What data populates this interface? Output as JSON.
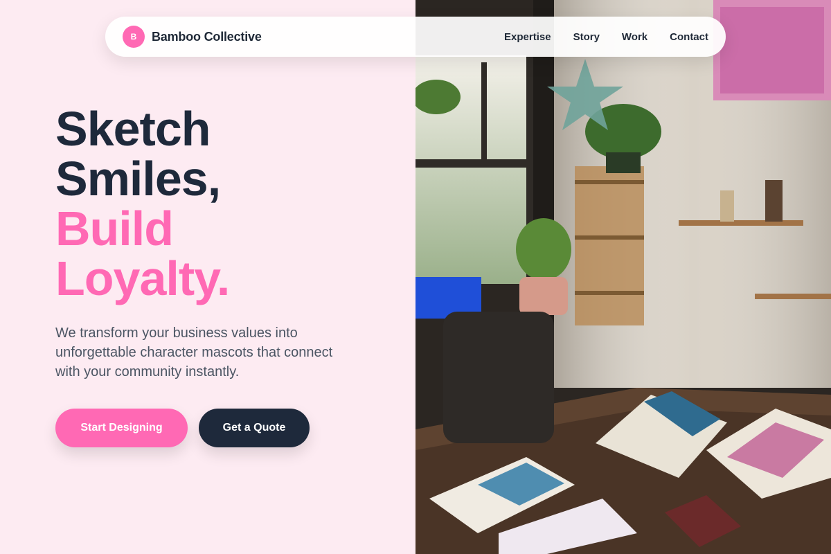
{
  "brand": {
    "mark": "B",
    "name": "Bamboo Collective"
  },
  "nav": {
    "items": [
      "Expertise",
      "Story",
      "Work",
      "Contact"
    ]
  },
  "hero": {
    "line1": "Sketch",
    "line2": "Smiles,",
    "line3": "Build",
    "line4": "Loyalty.",
    "subtitle": "We transform your business values into unforgettable character mascots that connect with your community instantly.",
    "primary_cta": "Start Designing",
    "secondary_cta": "Get a Quote"
  },
  "colors": {
    "accent": "#ff69b4",
    "dark": "#1e293b",
    "background": "#fdebf2"
  },
  "photo": {
    "subject": "art-studio-desk-photo"
  }
}
